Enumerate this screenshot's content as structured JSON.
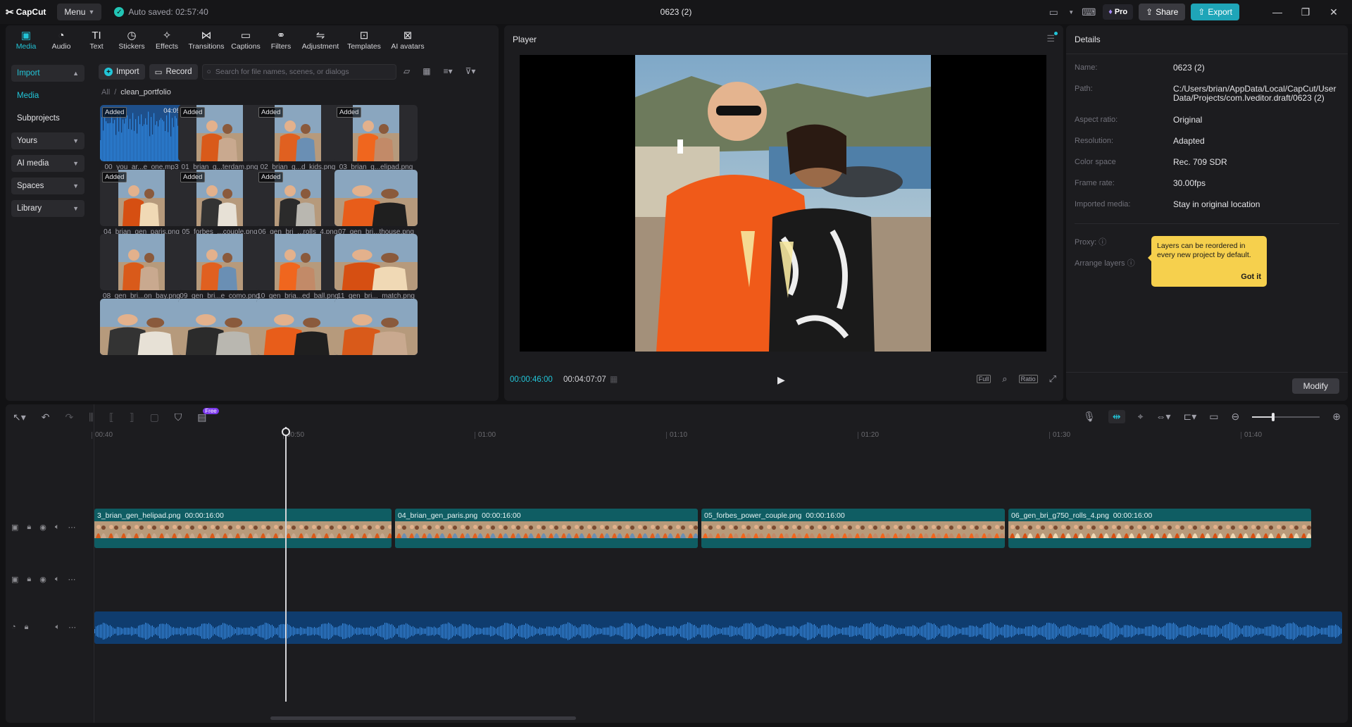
{
  "app": {
    "logo": "CapCut",
    "menu_label": "Menu",
    "autosave": "Auto saved: 02:57:40",
    "title": "0623 (2)"
  },
  "titlebar_right": {
    "pro": "Pro",
    "share": "Share",
    "export": "Export"
  },
  "toolbar": [
    {
      "label": "Media",
      "icon": "media-icon",
      "glyph": "▣",
      "active": true
    },
    {
      "label": "Audio",
      "icon": "audio-icon",
      "glyph": "◔"
    },
    {
      "label": "Text",
      "icon": "text-icon",
      "glyph": "TI"
    },
    {
      "label": "Stickers",
      "icon": "stickers-icon",
      "glyph": "◷"
    },
    {
      "label": "Effects",
      "icon": "effects-icon",
      "glyph": "✧"
    },
    {
      "label": "Transitions",
      "icon": "transitions-icon",
      "glyph": "⋈"
    },
    {
      "label": "Captions",
      "icon": "captions-icon",
      "glyph": "▭"
    },
    {
      "label": "Filters",
      "icon": "filters-icon",
      "glyph": "⚭"
    },
    {
      "label": "Adjustment",
      "icon": "adjustment-icon",
      "glyph": "⇋"
    },
    {
      "label": "Templates",
      "icon": "templates-icon",
      "glyph": "⊡"
    },
    {
      "label": "AI avatars",
      "icon": "ai-avatars-icon",
      "glyph": "⊠"
    }
  ],
  "leftnav": {
    "import": "Import",
    "media": "Media",
    "subprojects": "Subprojects",
    "yours": "Yours",
    "ai_media": "AI media",
    "spaces": "Spaces",
    "library": "Library"
  },
  "media": {
    "import_btn": "Import",
    "record_btn": "Record",
    "search_placeholder": "Search for file names, scenes, or dialogs",
    "breadcrumb_root": "All",
    "breadcrumb_sep": "/",
    "breadcrumb_current": "clean_portfolio",
    "added_label": "Added",
    "items": [
      {
        "name": "00_you_ar...e_one.mp3",
        "added": true,
        "duration": "04:05",
        "type": "audio"
      },
      {
        "name": "01_brian_g...terdam.png",
        "added": true
      },
      {
        "name": "02_brian_g...d_kids.png",
        "added": true
      },
      {
        "name": "03_brian_g...elipad.png",
        "added": true
      },
      {
        "name": "04_brian_gen_paris.png",
        "added": true
      },
      {
        "name": "05_forbes_...couple.png",
        "added": true
      },
      {
        "name": "06_gen_bri_...rolls_4.png",
        "added": true
      },
      {
        "name": "07_gen_bri...thouse.png",
        "added": false
      },
      {
        "name": "08_gen_bri...on_bay.png",
        "added": false
      },
      {
        "name": "09_gen_bri...e_como.png",
        "added": false
      },
      {
        "name": "10_gen_bria...ed_ball.png",
        "added": false
      },
      {
        "name": "11_gen_bri..._match.png",
        "added": false
      },
      {
        "name": "",
        "added": false
      },
      {
        "name": "",
        "added": false
      },
      {
        "name": "",
        "added": false
      },
      {
        "name": "",
        "added": false
      }
    ]
  },
  "player": {
    "title": "Player",
    "current_time": "00:00:46:00",
    "total_time": "00:04:07:07",
    "btn_full": "Full",
    "btn_ratio": "Ratio"
  },
  "details": {
    "title": "Details",
    "rows": [
      {
        "label": "Name:",
        "value": "0623 (2)"
      },
      {
        "label": "Path:",
        "value": "C:/Users/brian/AppData/Local/CapCut/User Data/Projects/com.lveditor.draft/0623 (2)"
      },
      {
        "label": "Aspect ratio:",
        "value": "Original"
      },
      {
        "label": "Resolution:",
        "value": "Adapted"
      },
      {
        "label": "Color space",
        "value": "Rec. 709 SDR"
      },
      {
        "label": "Frame rate:",
        "value": "30.00fps"
      },
      {
        "label": "Imported media:",
        "value": "Stay in original location"
      }
    ],
    "proxy_label": "Proxy:",
    "arrange_label": "Arrange layers",
    "tooltip_text": "Layers can be reordered in every new project by default.",
    "tooltip_button": "Got it",
    "modify_button": "Modify"
  },
  "timeline": {
    "free_badge": "Free",
    "ruler": [
      "00:40",
      "00:50",
      "01:00",
      "01:10",
      "01:20",
      "01:30",
      "01:40"
    ],
    "clips": [
      {
        "name": "3_brian_gen_helipad.png",
        "duration": "00:00:16:00"
      },
      {
        "name": "04_brian_gen_paris.png",
        "duration": "00:00:16:00"
      },
      {
        "name": "05_forbes_power_couple.png",
        "duration": "00:00:16:00"
      },
      {
        "name": "06_gen_bri_g750_rolls_4.png",
        "duration": "00:00:16:00"
      }
    ]
  },
  "colors": {
    "accent": "#22c5d8",
    "export": "#1fa5b8",
    "clip": "#0f5d63",
    "audio": "#0f3c6e",
    "tooltip": "#f6d04d"
  }
}
